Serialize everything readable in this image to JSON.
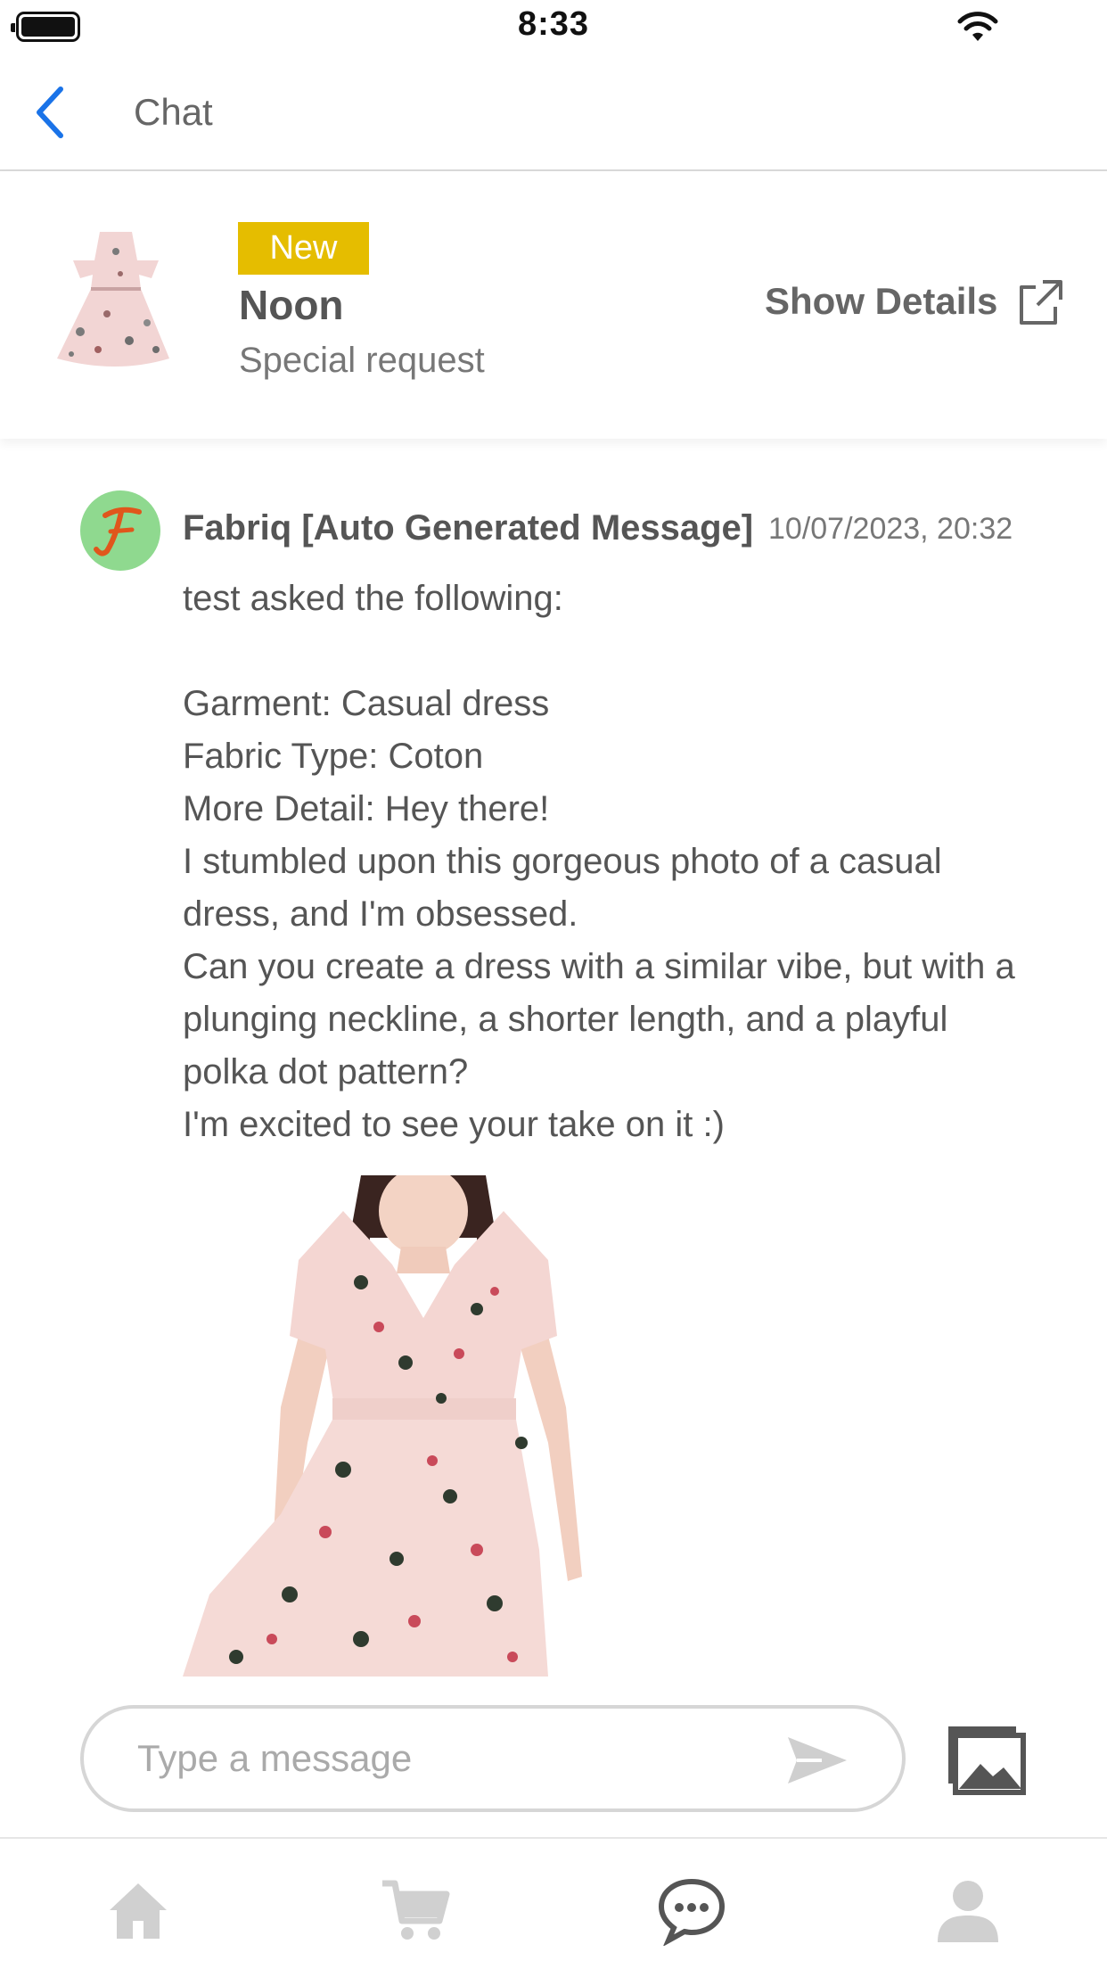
{
  "status_bar": {
    "time": "8:33"
  },
  "nav": {
    "title": "Chat"
  },
  "request": {
    "badge": "New",
    "name": "Noon",
    "type": "Special request",
    "show_details_label": "Show Details"
  },
  "message": {
    "sender": "Fabriq [Auto Generated Message]",
    "timestamp": "10/07/2023, 20:32",
    "intro": "test asked the following:",
    "lines": [
      "Garment: Casual dress",
      "Fabric Type: Coton",
      "More Detail: Hey there!",
      "I stumbled upon this gorgeous photo of a casual dress, and I'm obsessed.",
      "Can you create a dress with a similar vibe, but with a plunging neckline, a shorter length, and a playful polka dot pattern?",
      "I'm excited to see your take on it :)"
    ]
  },
  "composer": {
    "placeholder": "Type a message"
  },
  "tabs": [
    {
      "name": "home",
      "icon": "home-icon",
      "active": false
    },
    {
      "name": "cart",
      "icon": "cart-icon",
      "active": false
    },
    {
      "name": "chat",
      "icon": "chat-bubble-icon",
      "active": true
    },
    {
      "name": "profile",
      "icon": "profile-icon",
      "active": false
    }
  ],
  "colors": {
    "accent": "#1a73e8",
    "badge": "#e5bd00",
    "avatar_bg": "#8fd98f",
    "logo": "#e0561c"
  }
}
